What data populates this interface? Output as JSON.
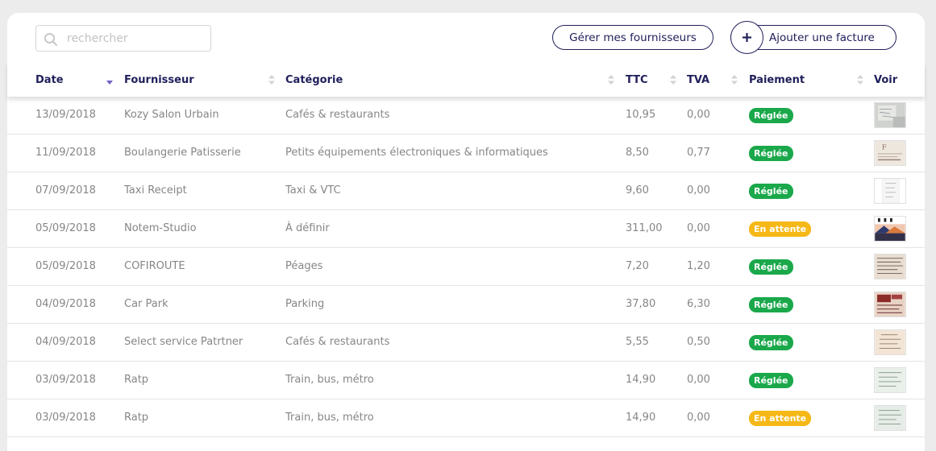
{
  "search": {
    "placeholder": "rechercher",
    "value": ""
  },
  "toolbar": {
    "manage_suppliers_label": "Gérer mes fournisseurs",
    "add_invoice_label": "Ajouter une facture",
    "add_icon": "plus-icon"
  },
  "columns": {
    "date": "Date",
    "supplier": "Fournisseur",
    "category": "Catégorie",
    "ttc": "TTC",
    "tva": "TVA",
    "payment": "Paiement",
    "view": "Voir"
  },
  "colors": {
    "brand": "#21205b",
    "paid": "#1aa84b",
    "pending": "#f6b817",
    "sort_active": "#6f63c9"
  },
  "rows": [
    {
      "date": "13/09/2018",
      "supplier": "Kozy Salon Urbain",
      "category": "Cafés & restaurants",
      "ttc": "10,95",
      "tva": "0,00",
      "status": "Réglée",
      "status_type": "ok",
      "thumb": "receipt-thumbnail"
    },
    {
      "date": "11/09/2018",
      "supplier": "Boulangerie Patisserie",
      "category": "Petits équipements électroniques & informatiques",
      "ttc": "8,50",
      "tva": "0,77",
      "status": "Réglée",
      "status_type": "ok",
      "thumb": "receipt-thumbnail"
    },
    {
      "date": "07/09/2018",
      "supplier": "Taxi Receipt",
      "category": "Taxi & VTC",
      "ttc": "9,60",
      "tva": "0,00",
      "status": "Réglée",
      "status_type": "ok",
      "thumb": "receipt-thumbnail"
    },
    {
      "date": "05/09/2018",
      "supplier": "Notem-Studio",
      "category": "À définir",
      "ttc": "311,00",
      "tva": "0,00",
      "status": "En attente",
      "status_type": "wait",
      "thumb": "receipt-thumbnail"
    },
    {
      "date": "05/09/2018",
      "supplier": "COFIROUTE",
      "category": "Péages",
      "ttc": "7,20",
      "tva": "1,20",
      "status": "Réglée",
      "status_type": "ok",
      "thumb": "receipt-thumbnail"
    },
    {
      "date": "04/09/2018",
      "supplier": "Car Park",
      "category": "Parking",
      "ttc": "37,80",
      "tva": "6,30",
      "status": "Réglée",
      "status_type": "ok",
      "thumb": "receipt-thumbnail"
    },
    {
      "date": "04/09/2018",
      "supplier": "Select service Patrtner",
      "category": "Cafés & restaurants",
      "ttc": "5,55",
      "tva": "0,50",
      "status": "Réglée",
      "status_type": "ok",
      "thumb": "receipt-thumbnail"
    },
    {
      "date": "03/09/2018",
      "supplier": "Ratp",
      "category": "Train, bus, métro",
      "ttc": "14,90",
      "tva": "0,00",
      "status": "Réglée",
      "status_type": "ok",
      "thumb": "receipt-thumbnail"
    },
    {
      "date": "03/09/2018",
      "supplier": "Ratp",
      "category": "Train, bus, métro",
      "ttc": "14,90",
      "tva": "0,00",
      "status": "En attente",
      "status_type": "wait",
      "thumb": "receipt-thumbnail"
    }
  ]
}
